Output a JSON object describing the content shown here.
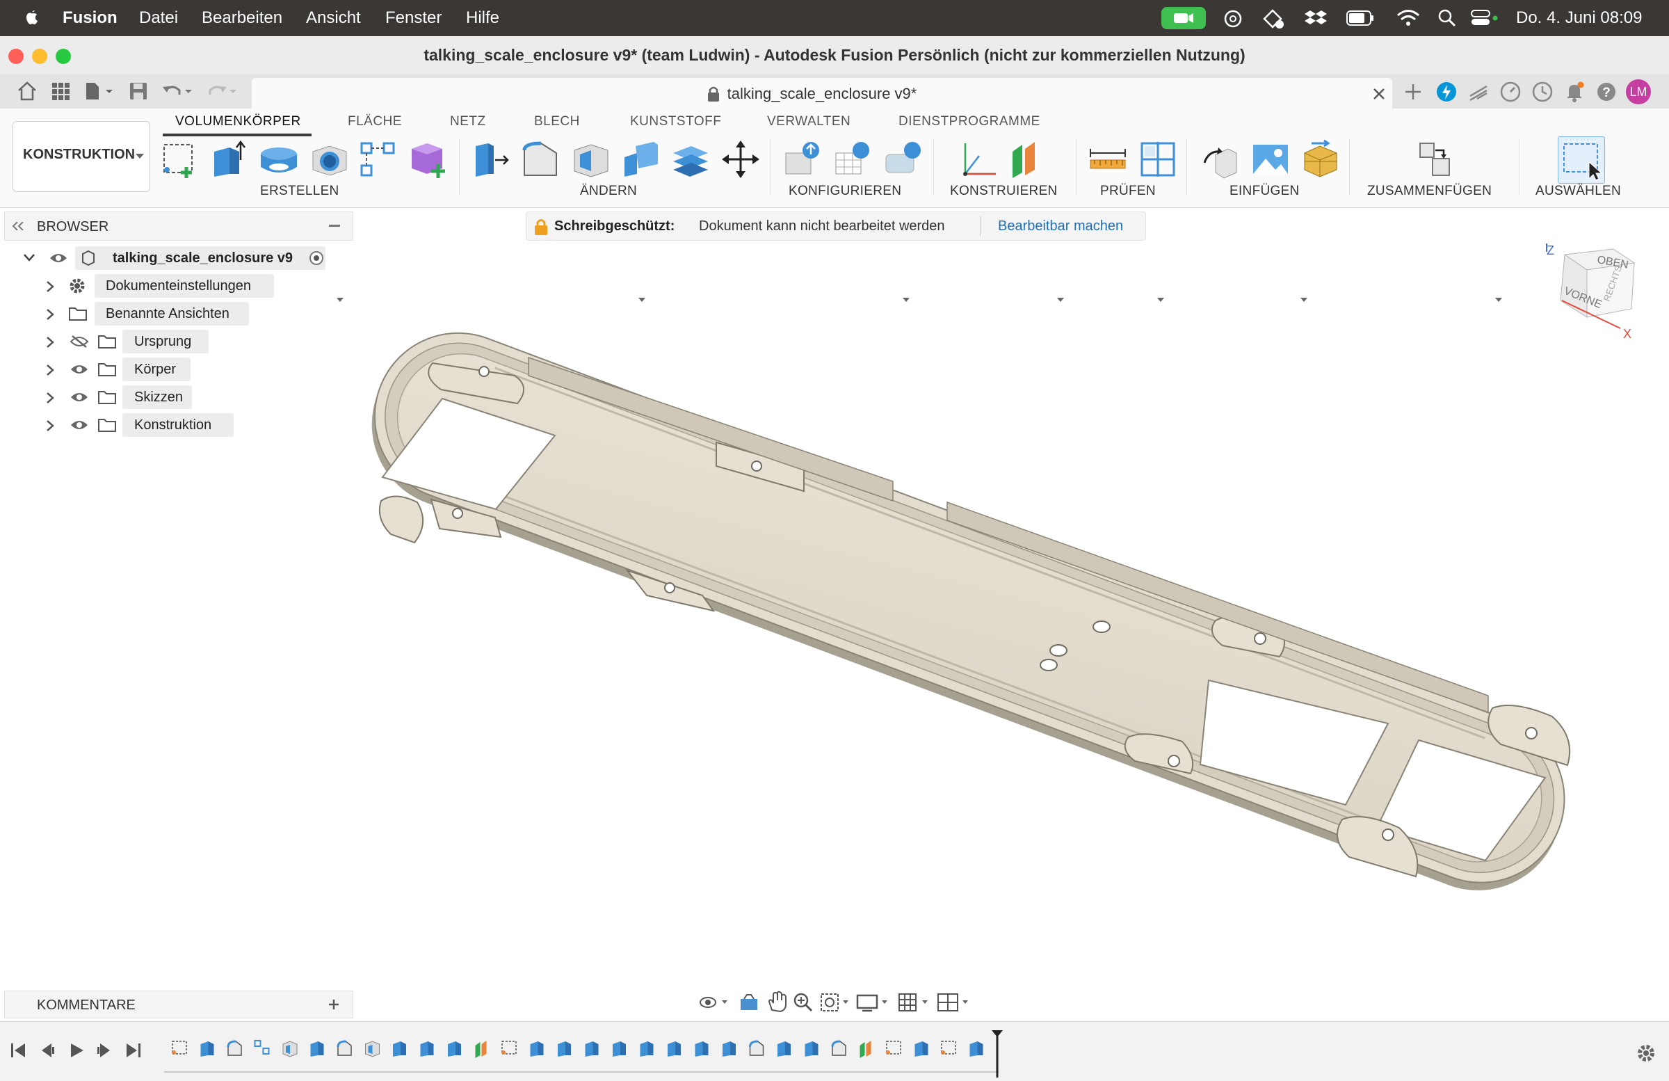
{
  "menubar": {
    "app": "Fusion",
    "items": [
      "Datei",
      "Bearbeiten",
      "Ansicht",
      "Fenster",
      "Hilfe"
    ],
    "clock": "Do. 4. Juni  08:09"
  },
  "window": {
    "title": "talking_scale_enclosure v9* (team Ludwin) - Autodesk Fusion Persönlich (nicht zur kommerziellen Nutzung)"
  },
  "doc_tab": {
    "title": "talking_scale_enclosure v9*",
    "avatar": "LM"
  },
  "ribbon": {
    "workspace": "KONSTRUKTION",
    "tabs": [
      "VOLUMENKÖRPER",
      "FLÄCHE",
      "NETZ",
      "BLECH",
      "KUNSTSTOFF",
      "VERWALTEN",
      "DIENSTPROGRAMME"
    ],
    "groups": [
      "ERSTELLEN",
      "ÄNDERN",
      "KONFIGURIEREN",
      "KONSTRUIEREN",
      "PRÜFEN",
      "EINFÜGEN",
      "ZUSAMMENFÜGEN",
      "AUSWÄHLEN"
    ]
  },
  "browser": {
    "title": "BROWSER",
    "root": "talking_scale_enclosure v9",
    "items": [
      "Dokumenteinstellungen",
      "Benannte Ansichten",
      "Ursprung",
      "Körper",
      "Skizzen",
      "Konstruktion"
    ]
  },
  "notice": {
    "label": "Schreibgeschützt:",
    "message": "Dokument kann nicht bearbeitet werden",
    "action": "Bearbeitbar machen"
  },
  "viewcube": {
    "top": "OBEN",
    "front": "VORNE",
    "right": "RECHTS",
    "axis_z": "Z",
    "axis_x": "X"
  },
  "comments": {
    "title": "KOMMENTARE"
  },
  "colors": {
    "accent": "#0696d7",
    "avatar": "#c53ea0",
    "model_face": "#e3ddd0",
    "model_edge": "#8a8476"
  }
}
